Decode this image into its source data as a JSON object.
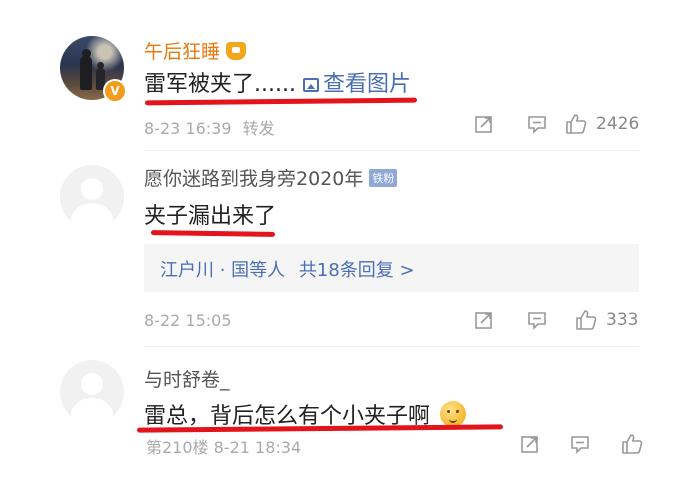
{
  "colors": {
    "username_highlight": "#e8790f",
    "link": "#4a6fb5",
    "underline": "#e3141c",
    "meta": "#aaaaaa"
  },
  "comments": [
    {
      "username": "午后狂睡",
      "badge_icon": "crown-icon",
      "verified_badge": "V",
      "text": "雷军被夹了......",
      "image_link": "查看图片",
      "meta": "8-23 16:39",
      "repost_label": "转发",
      "likes": "2426"
    },
    {
      "username": "愿你迷路到我身旁2020年",
      "fan_badge": "铁粉",
      "text": "夹子漏出来了",
      "reply_preview": "江户川 · 国等人",
      "reply_count": "共18条回复 >",
      "meta": "8-22 15:05",
      "likes": "333"
    },
    {
      "username": "与时舒卷_",
      "text": "雷总，背后怎么有个小夹子啊",
      "emoji": "thinking-emoji",
      "meta": "第210楼 8-21 18:34"
    }
  ]
}
